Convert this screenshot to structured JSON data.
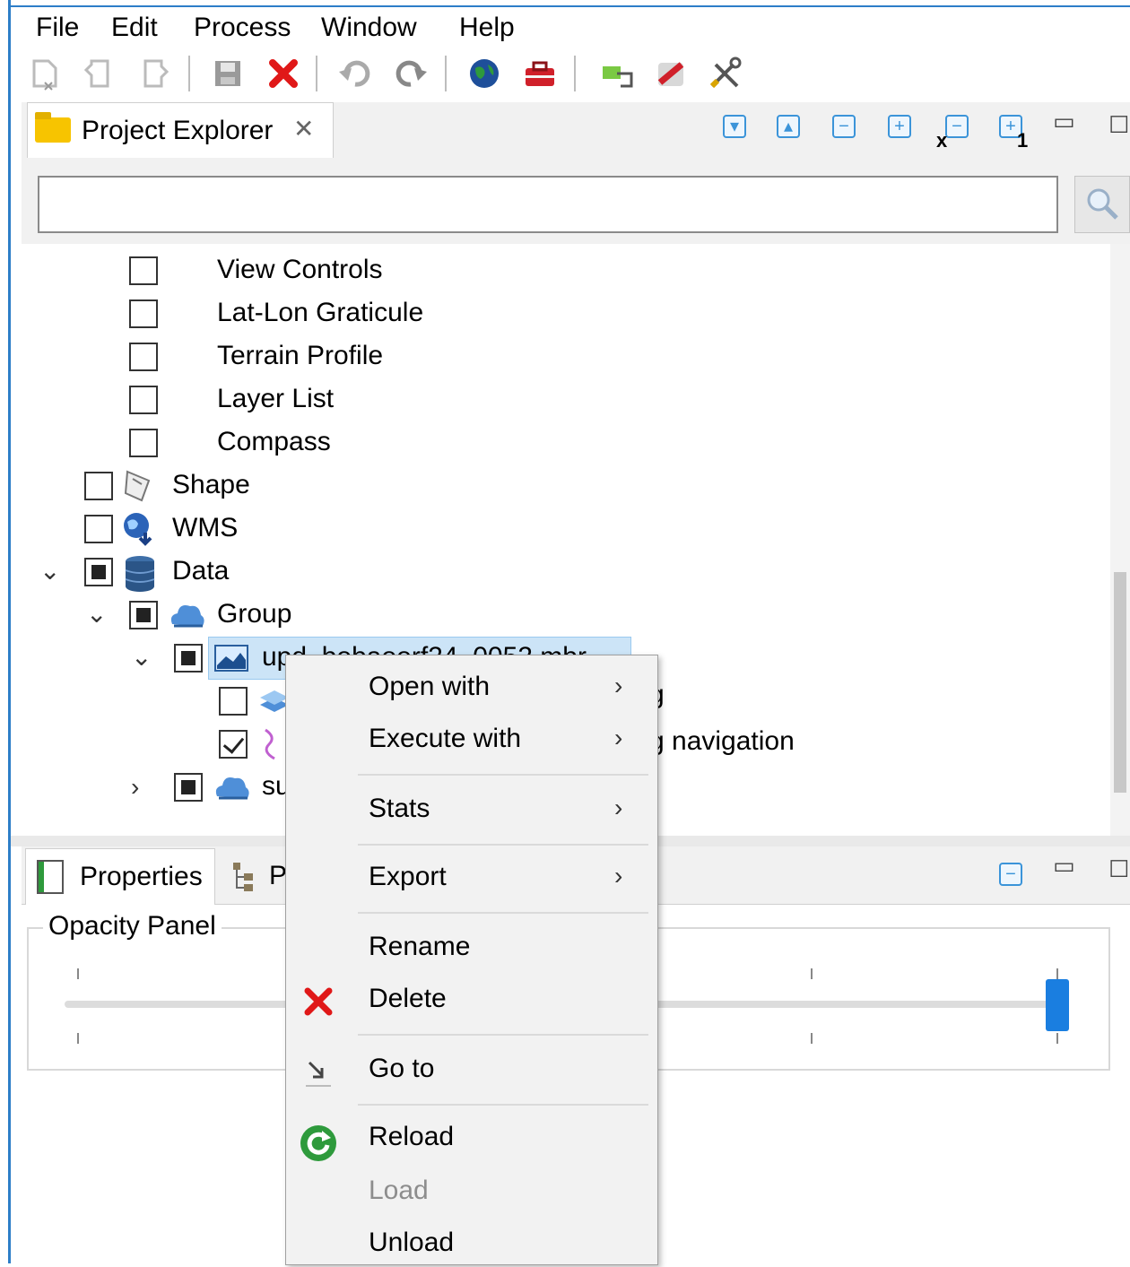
{
  "menu": {
    "items": [
      "File",
      "Edit",
      "Process",
      "Window",
      "Help"
    ]
  },
  "project_explorer": {
    "tab_title": "Project Explorer",
    "close_glyph": "✕",
    "filter": {
      "value": "",
      "placeholder": ""
    }
  },
  "tree": {
    "items": [
      {
        "label": "View Controls",
        "checked": false
      },
      {
        "label": "Lat-Lon Graticule",
        "checked": false
      },
      {
        "label": "Terrain Profile",
        "checked": false
      },
      {
        "label": "Layer List",
        "checked": false
      },
      {
        "label": "Compass",
        "checked": false
      },
      {
        "label": "Shape",
        "checked": false,
        "icon": "shape-icon"
      },
      {
        "label": "WMS",
        "checked": false,
        "icon": "wms-globe-icon"
      },
      {
        "label": "Data",
        "state": "partial",
        "expanded": true,
        "icon": "database-icon"
      },
      {
        "label": "Group",
        "state": "partial",
        "expanded": true,
        "icon": "cloud-group-icon"
      },
      {
        "label": "upd_bobaoorf24_0052.mbr",
        "state": "partial",
        "expanded": true,
        "selected": true,
        "icon": "raster-icon"
      },
      {
        "label": "g",
        "checked": false,
        "icon": "layers-icon"
      },
      {
        "label": "g navigation",
        "checked": true,
        "icon": "path-icon"
      },
      {
        "label": "su",
        "state": "partial",
        "expanded": false,
        "icon": "cloud-group-icon"
      }
    ]
  },
  "properties": {
    "tab_title": "Properties",
    "second_tab_prefix": "P",
    "opacity_panel_label": "Opacity Panel",
    "opacity_value": 1.0
  },
  "context_menu": {
    "items": [
      {
        "label": "Open with",
        "submenu": true
      },
      {
        "label": "Execute with",
        "submenu": true
      },
      {
        "label": "Stats",
        "submenu": true
      },
      {
        "label": "Export",
        "submenu": true
      },
      {
        "label": "Rename"
      },
      {
        "label": "Delete",
        "icon": "delete-icon"
      },
      {
        "label": "Go to",
        "icon": "goto-icon"
      },
      {
        "label": "Reload",
        "icon": "reload-icon"
      },
      {
        "label": "Load",
        "disabled": true
      },
      {
        "label": "Unload"
      }
    ],
    "submenu_arrow": "›"
  },
  "colors": {
    "accent": "#3b94d9",
    "slider": "#1a7ee0",
    "delete_red": "#e01818"
  }
}
